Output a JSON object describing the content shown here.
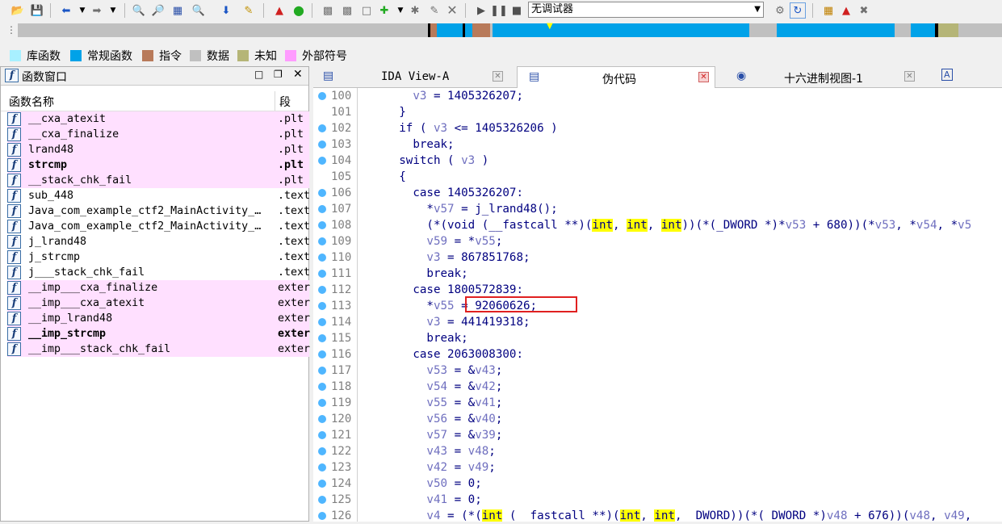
{
  "toolbar": {
    "debugger_select": "无调试器"
  },
  "navbar": {
    "segments": [
      {
        "color": "#c0c0c0"
      },
      {
        "color": "#000000"
      },
      {
        "color": "#b87a5a"
      },
      {
        "color": "#00a2e8"
      },
      {
        "color": "#000000"
      },
      {
        "color": "#00a2e8"
      },
      {
        "color": "#b87a5a"
      },
      {
        "color": "#00a2e8"
      },
      {
        "color": "#c0c0c0"
      },
      {
        "color": "#00a2e8"
      },
      {
        "color": "#c0c0c0"
      },
      {
        "color": "#00a2e8"
      },
      {
        "color": "#000000"
      },
      {
        "color": "#b5b577"
      },
      {
        "color": "#c0c0c0"
      }
    ]
  },
  "legend": [
    {
      "label": "库函数",
      "color": "#a8f0ff"
    },
    {
      "label": "常规函数",
      "color": "#00a2e8"
    },
    {
      "label": "指令",
      "color": "#b87a5a"
    },
    {
      "label": "数据",
      "color": "#c0c0c0"
    },
    {
      "label": "未知",
      "color": "#b5b577"
    },
    {
      "label": "外部符号",
      "color": "#ff9cff"
    }
  ],
  "function_window": {
    "title": "函数窗口",
    "col_name": "函数名称",
    "col_segment": "段",
    "functions": [
      {
        "name": "__cxa_atexit",
        "segment": ".plt",
        "external": true,
        "bold": false
      },
      {
        "name": "__cxa_finalize",
        "segment": ".plt",
        "external": true,
        "bold": false
      },
      {
        "name": "lrand48",
        "segment": ".plt",
        "external": true,
        "bold": false
      },
      {
        "name": "strcmp",
        "segment": ".plt",
        "external": true,
        "bold": true
      },
      {
        "name": "__stack_chk_fail",
        "segment": ".plt",
        "external": true,
        "bold": false
      },
      {
        "name": "sub_448",
        "segment": ".text",
        "external": false,
        "bold": false
      },
      {
        "name": "Java_com_example_ctf2_MainActivity_…",
        "segment": ".text",
        "external": false,
        "bold": false
      },
      {
        "name": "Java_com_example_ctf2_MainActivity_…",
        "segment": ".text",
        "external": false,
        "bold": false
      },
      {
        "name": "j_lrand48",
        "segment": ".text",
        "external": false,
        "bold": false
      },
      {
        "name": "j_strcmp",
        "segment": ".text",
        "external": false,
        "bold": false
      },
      {
        "name": "j___stack_chk_fail",
        "segment": ".text",
        "external": false,
        "bold": false
      },
      {
        "name": "__imp___cxa_finalize",
        "segment": "extern",
        "external": true,
        "bold": false
      },
      {
        "name": "__imp___cxa_atexit",
        "segment": "extern",
        "external": true,
        "bold": false
      },
      {
        "name": "__imp_lrand48",
        "segment": "extern",
        "external": true,
        "bold": false
      },
      {
        "name": "__imp_strcmp",
        "segment": "extern",
        "external": true,
        "bold": true
      },
      {
        "name": "__imp___stack_chk_fail",
        "segment": "extern",
        "external": true,
        "bold": false
      }
    ]
  },
  "tabs": [
    {
      "label": "IDA View-A",
      "active": false
    },
    {
      "label": "伪代码",
      "active": true
    },
    {
      "label": "十六进制视图-1",
      "active": false
    }
  ],
  "code_lines": [
    {
      "n": "100",
      "text": "        v3 = 1405326207;"
    },
    {
      "n": "101",
      "text": "      }"
    },
    {
      "n": "102",
      "text": "      if ( v3 <= 1405326206 )"
    },
    {
      "n": "103",
      "text": "        break;"
    },
    {
      "n": "104",
      "text": "      switch ( v3 )"
    },
    {
      "n": "105",
      "text": "      {"
    },
    {
      "n": "106",
      "text": "        case 1405326207:"
    },
    {
      "n": "107",
      "text": "          *v57 = j_lrand48();"
    },
    {
      "n": "108",
      "text": "          (*(void (__fastcall **)(int, int, int))(*(_DWORD *)*v53 + 680))(*v53, *v54, *v5"
    },
    {
      "n": "109",
      "text": "          v59 = *v55;"
    },
    {
      "n": "110",
      "text": "          v3 = 867851768;"
    },
    {
      "n": "111",
      "text": "          break;"
    },
    {
      "n": "112",
      "text": "        case 1800572839:"
    },
    {
      "n": "113",
      "text": "          *v55 = 92060626;"
    },
    {
      "n": "114",
      "text": "          v3 = 441419318;"
    },
    {
      "n": "115",
      "text": "          break;"
    },
    {
      "n": "116",
      "text": "        case 2063008300:"
    },
    {
      "n": "117",
      "text": "          v53 = &v43;"
    },
    {
      "n": "118",
      "text": "          v54 = &v42;"
    },
    {
      "n": "119",
      "text": "          v55 = &v41;"
    },
    {
      "n": "120",
      "text": "          v56 = &v40;"
    },
    {
      "n": "121",
      "text": "          v57 = &v39;"
    },
    {
      "n": "122",
      "text": "          v43 = v48;"
    },
    {
      "n": "123",
      "text": "          v42 = v49;"
    },
    {
      "n": "124",
      "text": "          v50 = 0;"
    },
    {
      "n": "125",
      "text": "          v41 = 0;"
    },
    {
      "n": "126",
      "text": "          v4 = (*(int (__fastcall **)(int, int, _DWORD))(*(_DWORD *)v48 + 676))(v48, v49,"
    }
  ]
}
